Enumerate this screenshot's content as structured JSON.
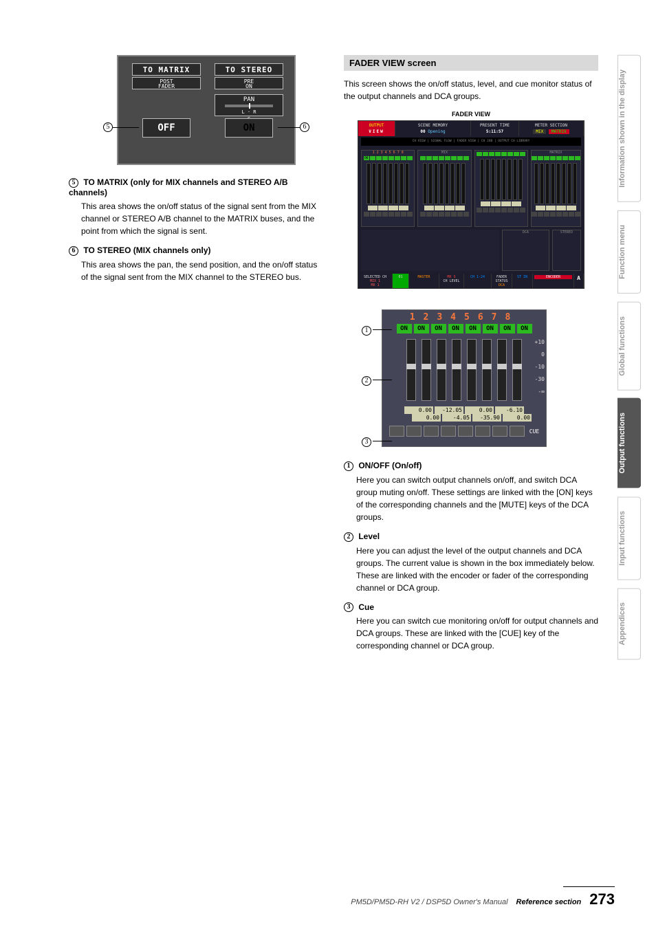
{
  "left": {
    "shot1": {
      "to_matrix": "TO MATRIX",
      "to_stereo": "TO STEREO",
      "post_fader": "POST\nFADER",
      "pre_on": "PRE\nON",
      "pan": "PAN",
      "off": "OFF",
      "on": "ON",
      "lcr": "L · R\nC"
    },
    "callout5": "5",
    "callout6": "6",
    "item5": {
      "head": "TO MATRIX (only for MIX channels and STEREO A/B channels)",
      "body": "This area shows the on/off status of the signal sent from the MIX channel or STEREO A/B channel to the MATRIX buses, and the point from which the signal is sent."
    },
    "item6": {
      "head": "TO STEREO (MIX channels only)",
      "body": "This area shows the pan, the send position, and the on/off status of the signal sent from the MIX channel to the STEREO bus."
    }
  },
  "right": {
    "section": "FADER VIEW screen",
    "intro": "This screen shows the on/off status, level, and cue monitor status of the output channels and DCA groups.",
    "fader_view_label": "FADER VIEW",
    "shot2": {
      "output": "OUTPUT",
      "view": "VIEW",
      "scene_memory": "SCENE MEMORY",
      "scene_num": "00",
      "scene_name": "Opening",
      "present_time_label": "PRESENT TIME",
      "present_time": "5:11:57",
      "meter_label": "METER SECTION",
      "meter_l": "MIX",
      "meter_r": "MATRIX",
      "tabs": "CH VIEW | SIGNAL FLOW | FADER VIEW | CH JOB | OUTPUT CH LIBRARY",
      "mix_label": "MIX",
      "matrix_label": "MATRIX",
      "dca_label": "DCA",
      "stereo_label": "STEREO",
      "sel_ch_label": "SELECTED CH",
      "sel_ch": "MIX 1\nMX 1",
      "machine": "01",
      "mix_section": "MASTER",
      "mix_s": "MX S",
      "ch_level": "CH LEVEL",
      "input_ch": "CH 1-24",
      "fader_status_label": "FADER STATUS",
      "dca": "DCA",
      "st_in": "ST IN",
      "encoder": "ENCODER",
      "a": "A"
    },
    "shot3": {
      "nums": "12345678",
      "on": "ON",
      "scale": [
        "+10",
        "0",
        "-10",
        "-30",
        "-∞"
      ],
      "vals_top": [
        "0.00",
        "-12.05",
        "0.00",
        "-6.10"
      ],
      "vals_bot": [
        "0.00",
        "-4.05",
        "-35.90",
        "0.00"
      ],
      "cue": "CUE"
    },
    "callout1": "1",
    "callout2": "2",
    "callout3": "3",
    "item1": {
      "head": "ON/OFF (On/off)",
      "body": "Here you can switch output channels on/off, and switch DCA group muting on/off. These settings are linked with the [ON] keys of the corresponding channels and the [MUTE] keys of the DCA groups."
    },
    "item2": {
      "head": "Level",
      "body": "Here you can adjust the level of the output channels and DCA groups. The current value is shown in the box immediately below. These are linked with the encoder or fader of the corresponding channel or DCA group."
    },
    "item3": {
      "head": "Cue",
      "body": "Here you can switch cue monitoring on/off for output channels and DCA groups. These are linked with the [CUE] key of the corresponding channel or DCA group."
    }
  },
  "side_tabs": [
    "Information shown in the display",
    "Function menu",
    "Global functions",
    "Output functions",
    "Input functions",
    "Appendices"
  ],
  "footer": {
    "model": "PM5D/PM5D-RH V2 / DSP5D Owner's Manual",
    "section": "Reference section",
    "page": "273"
  }
}
